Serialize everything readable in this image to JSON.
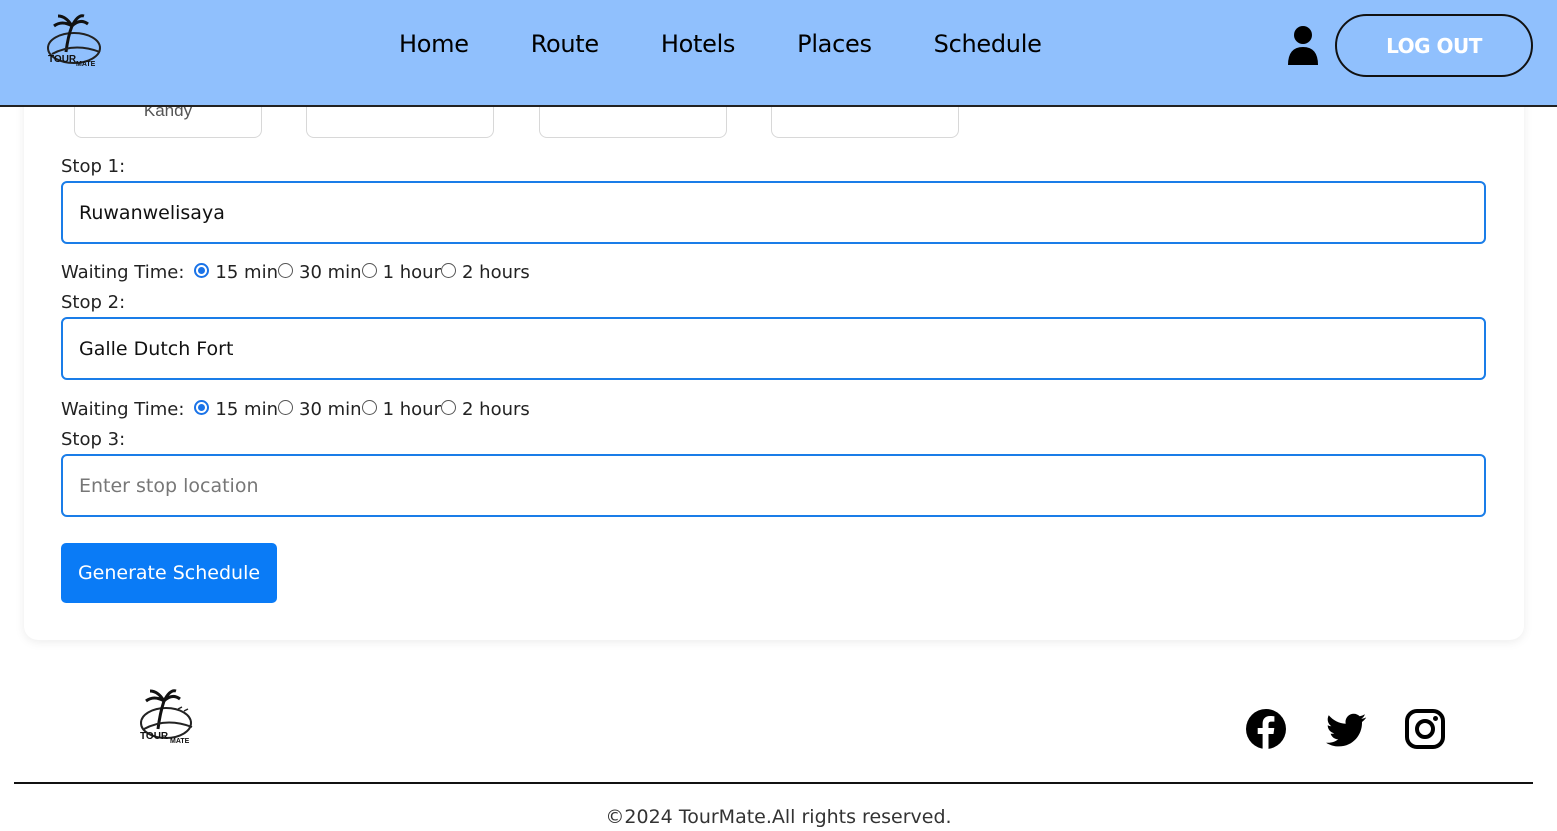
{
  "header": {
    "logo_text": "TOUR MATE",
    "nav": [
      "Home",
      "Route",
      "Hotels",
      "Places",
      "Schedule"
    ],
    "logout_label": "LOG OUT"
  },
  "destinations": {
    "chips": [
      "Kandy",
      "",
      "",
      ""
    ]
  },
  "stops": [
    {
      "label": "Stop 1:",
      "value": "Ruwanwelisaya",
      "placeholder": "Enter stop location"
    },
    {
      "label": "Stop 2:",
      "value": "Galle Dutch Fort",
      "placeholder": "Enter stop location"
    },
    {
      "label": "Stop 3:",
      "value": "",
      "placeholder": "Enter stop location"
    }
  ],
  "waiting": {
    "label": "Waiting Time:",
    "options": [
      "15 min",
      "30 min",
      "1 hour",
      "2 hours"
    ],
    "selected": "15 min"
  },
  "generate_label": "Generate Schedule",
  "footer": {
    "logo_text": "TOUR MATE",
    "social": [
      "facebook-icon",
      "twitter-icon",
      "instagram-icon"
    ],
    "copyright": "©2024 TourMate.All rights reserved."
  },
  "colors": {
    "header_bg": "#90c0fd",
    "accent": "#0a7bf6",
    "input_border": "#1a7de8"
  }
}
